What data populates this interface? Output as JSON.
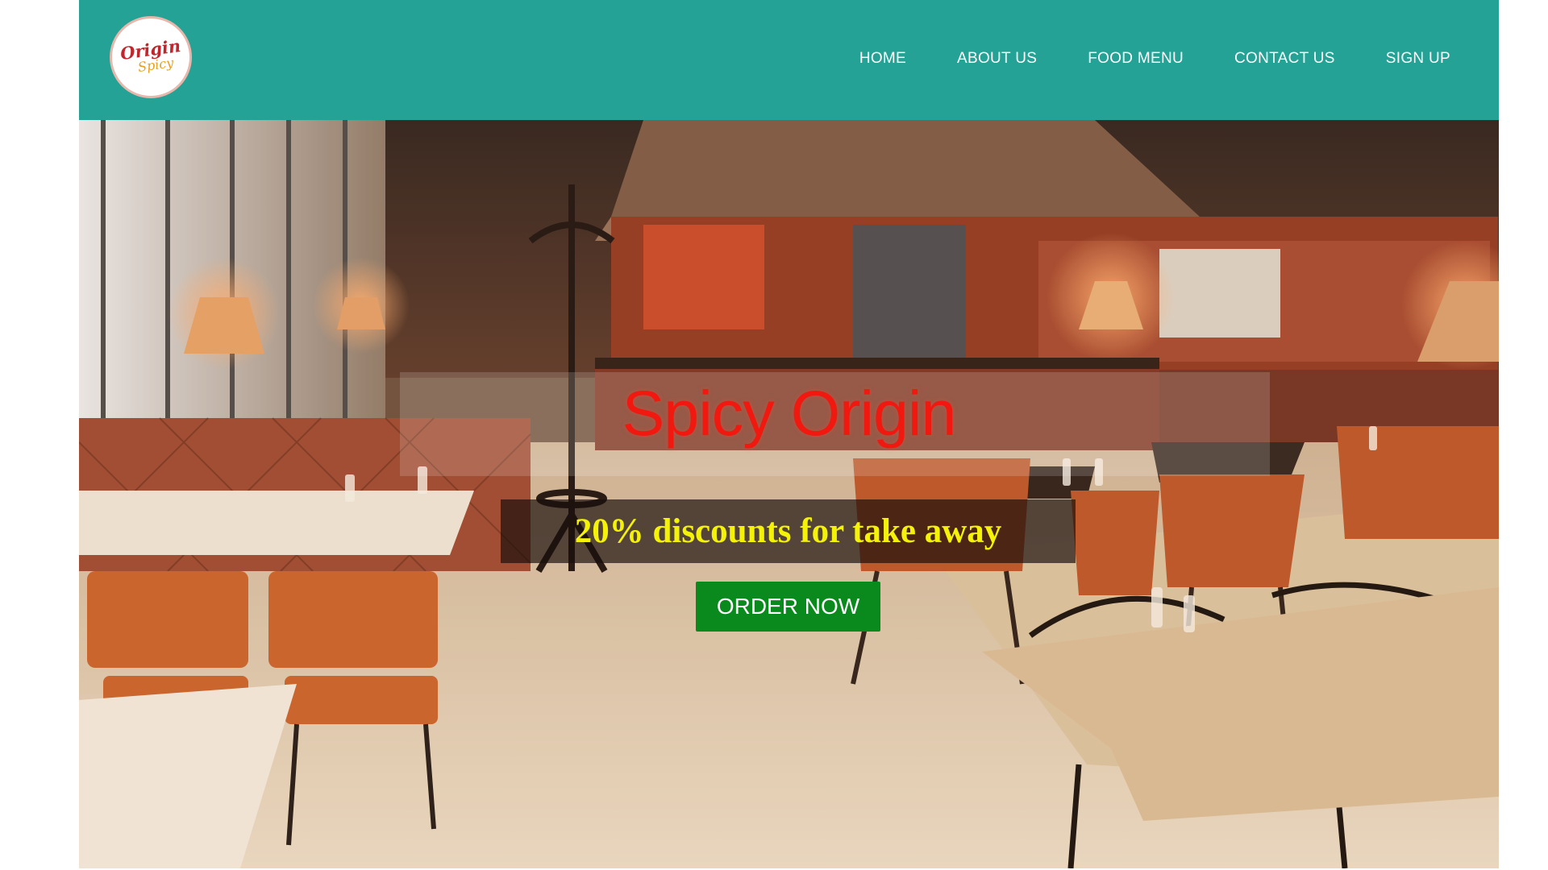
{
  "logo": {
    "word_1": "Origin",
    "word_2": "Spicy"
  },
  "nav": {
    "items": [
      {
        "label": "HOME"
      },
      {
        "label": "ABOUT US"
      },
      {
        "label": "FOOD MENU"
      },
      {
        "label": "CONTACT US"
      },
      {
        "label": "SIGN UP"
      }
    ]
  },
  "hero": {
    "title": "Spicy Origin",
    "discount": "20% discounts for take away",
    "button_label": "ORDER NOW"
  },
  "colors": {
    "header_bg": "#23a295",
    "title_red": "#f0180f",
    "discount_yellow": "#f5f20a",
    "button_green": "#0a8a1c"
  }
}
